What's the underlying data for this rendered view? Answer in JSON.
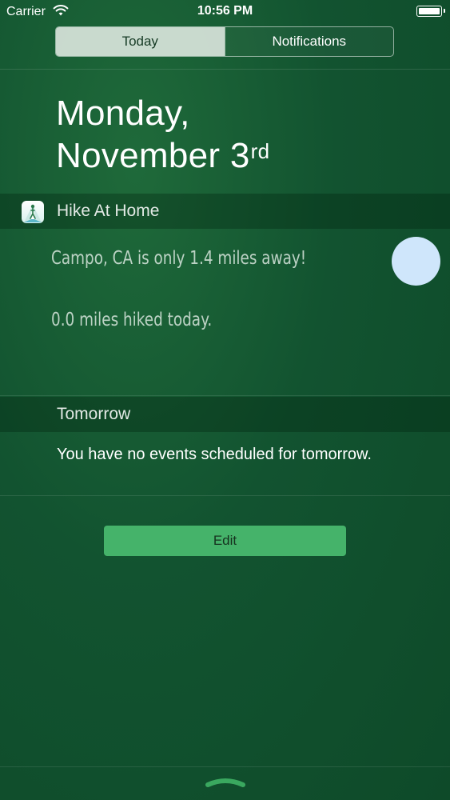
{
  "status_bar": {
    "carrier": "Carrier",
    "time": "10:56 PM",
    "wifi_icon": "wifi-icon",
    "battery_icon": "battery-icon"
  },
  "tabs": [
    {
      "label": "Today",
      "selected": true
    },
    {
      "label": "Notifications",
      "selected": false
    }
  ],
  "date": {
    "line1": "Monday,",
    "line2_main": "November 3",
    "line2_suffix": "rd"
  },
  "widget": {
    "app_name": "Hike At Home",
    "app_icon": "hiker-icon",
    "message_1": "Campo, CA is only 1.4 miles away!",
    "message_2": "0.0 miles hiked today."
  },
  "tomorrow": {
    "title": "Tomorrow",
    "message": "You have no events scheduled for tomorrow."
  },
  "edit_label": "Edit",
  "colors": {
    "background": "#125330",
    "edit_button": "#45b36a",
    "circle_button": "#cfe6fb",
    "tab_selected": "#e1ebe4"
  }
}
